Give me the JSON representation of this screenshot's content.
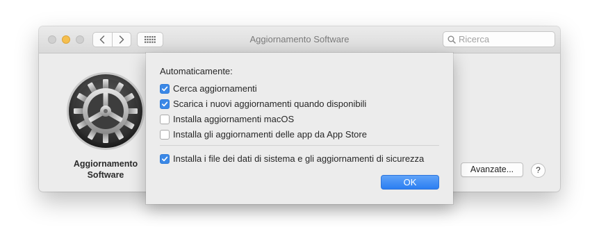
{
  "window": {
    "title": "Aggiornamento Software",
    "search_placeholder": "Ricerca"
  },
  "pane": {
    "app_label_line1": "Aggiornamento",
    "app_label_line2": "Software",
    "advanced_button": "Avanzate...",
    "help_button": "?"
  },
  "sheet": {
    "heading": "Automaticamente:",
    "options": [
      {
        "label": "Cerca aggiornamenti",
        "checked": true
      },
      {
        "label": "Scarica i nuovi aggiornamenti quando disponibili",
        "checked": true
      },
      {
        "label": "Installa aggiornamenti macOS",
        "checked": false
      },
      {
        "label": "Installa gli aggiornamenti delle app da App Store",
        "checked": false
      }
    ],
    "security_option": {
      "label": "Installa i file dei dati di sistema e gli aggiornamenti di sicurezza",
      "checked": true
    },
    "ok_button": "OK"
  },
  "colors": {
    "accent": "#3b88e6",
    "minimize": "#f5bf4f"
  },
  "icons": [
    "search-icon",
    "chevron-left-icon",
    "chevron-right-icon",
    "grid-icon",
    "gear-icon",
    "checkmark-icon"
  ]
}
